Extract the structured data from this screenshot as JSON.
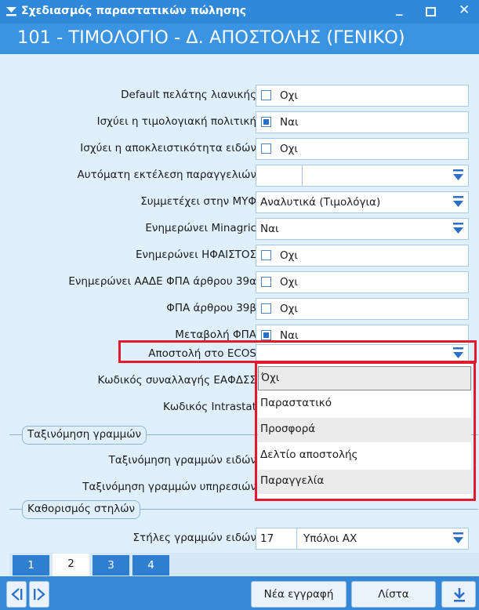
{
  "window": {
    "title": "Σχεδιασμός παραστατικών πώλησης",
    "header": "101 - ΤΙΜΟΛΟΓΙΟ - Δ. ΑΠΟΣΤΟΛΗΣ (ΓΕΝΙΚΟ)"
  },
  "fields": {
    "default_retail": {
      "label": "Default πελάτης λιανικής",
      "value": "Οχι",
      "checked": false
    },
    "pricing_policy": {
      "label": "Ισχύει η τιμολογιακή πολιτική",
      "value": "Ναι",
      "checked": true
    },
    "exclusivity": {
      "label": "Ισχύει η αποκλειστικότητα ειδών",
      "value": "Οχι",
      "checked": false
    },
    "auto_orders": {
      "label": "Αυτόματη εκτέλεση παραγγελιών",
      "value": ""
    },
    "myf": {
      "label": "Συμμετέχει στην ΜΥΦ",
      "value": "Αναλυτικά (Τιμολόγια)"
    },
    "minagric": {
      "label": "Ενημερώνει Minagric",
      "value": "Ναι"
    },
    "hfaistos": {
      "label": "Ενημερώνει ΗΦΑΙΣΤΟΣ",
      "value": "Οχι",
      "checked": false
    },
    "aade39a": {
      "label": "Ενημερώνει ΑΑΔΕ ΦΠΑ άρθρου 39α",
      "value": "Οχι",
      "checked": false
    },
    "vat39b": {
      "label": "ΦΠΑ άρθρου 39β",
      "value": "Οχι",
      "checked": false
    },
    "vat_change": {
      "label": "Μεταβολή ΦΠΑ",
      "value": "Ναι",
      "checked": true
    },
    "ecos": {
      "label": "Αποστολή στο ECOS",
      "value": ""
    },
    "eafdss": {
      "label": "Κωδικός συναλλαγής ΕΑΦΔΣΣ"
    },
    "intrastat": {
      "label": "Κωδικός Intrastat"
    },
    "item_lines_sort": {
      "label": "Ταξινόμηση γραμμών ειδών"
    },
    "service_lines_sort": {
      "label": "Ταξινόμηση γραμμών υπηρεσιών"
    },
    "item_columns": {
      "label": "Στήλες γραμμών ειδών",
      "value": "17",
      "value2": "Υπόλοι ΑΧ"
    }
  },
  "sections": {
    "line_sort": "Ταξινόμηση γραμμών",
    "columns": "Καθορισμός στηλών"
  },
  "dropdown": {
    "options": [
      "Όχι",
      "Παραστατικό",
      "Προσφορά",
      "Δελτίο αποστολής",
      "Παραγγελία"
    ],
    "selected": "Όχι"
  },
  "tabs": [
    "1",
    "2",
    "3",
    "4"
  ],
  "active_tab": "2",
  "buttons": {
    "new_record": "Νέα εγγραφή",
    "list": "Λίστα"
  },
  "colors": {
    "titlebar": "#2f88d9",
    "header": "#3a94e2",
    "form_bg": "#dff0fc",
    "highlight": "#e21a2e"
  }
}
